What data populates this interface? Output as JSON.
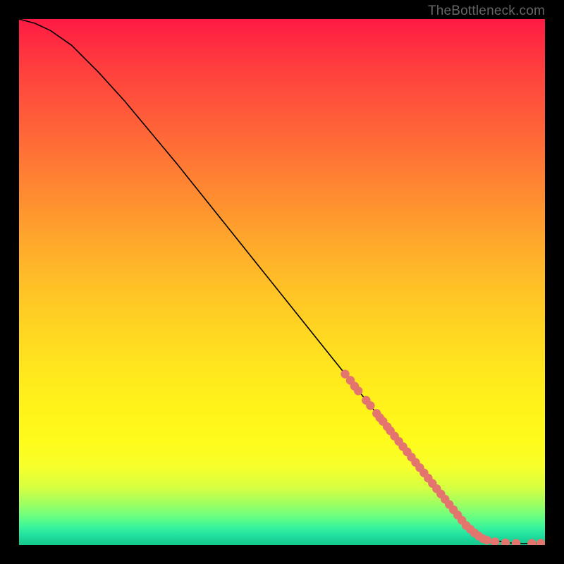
{
  "watermark": "TheBottleneck.com",
  "colors": {
    "dot": "#e4746e",
    "curve": "#000000"
  },
  "chart_data": {
    "type": "line",
    "title": "",
    "xlabel": "",
    "ylabel": "",
    "xlim": [
      0,
      100
    ],
    "ylim": [
      0,
      100
    ],
    "curve": {
      "x": [
        0,
        3,
        6,
        10,
        15,
        20,
        30,
        40,
        50,
        60,
        70,
        78,
        83,
        86,
        90,
        94,
        100
      ],
      "y": [
        100,
        99.2,
        97.8,
        95,
        90,
        84.5,
        72.5,
        60,
        47.5,
        35,
        22.5,
        12.5,
        6,
        2.7,
        0.9,
        0.3,
        0.3
      ]
    },
    "series": [
      {
        "name": "markers",
        "type": "scatter",
        "x": [
          62,
          63,
          63.8,
          64.5,
          66,
          66.8,
          68,
          68.6,
          69.2,
          70,
          70.6,
          71.4,
          72.2,
          73,
          73.8,
          74.6,
          75.4,
          76.2,
          77,
          77.8,
          78.6,
          79.4,
          80.2,
          81,
          81.8,
          82.6,
          83.4,
          84.2,
          85,
          85.8,
          86.6,
          87.4,
          88.2,
          89,
          90.5,
          92.5,
          94.5,
          97.5,
          99.2
        ],
        "y": [
          32.5,
          31.3,
          30.2,
          29.3,
          27.5,
          26.5,
          25,
          24.2,
          23.5,
          22.5,
          21.7,
          20.7,
          19.7,
          18.7,
          17.7,
          16.7,
          15.7,
          14.7,
          13.7,
          12.7,
          11.7,
          10.7,
          9.7,
          8.7,
          7.7,
          6.7,
          5.7,
          4.7,
          3.7,
          3,
          2.3,
          1.7,
          1.2,
          0.9,
          0.6,
          0.4,
          0.3,
          0.3,
          0.3
        ]
      }
    ]
  }
}
